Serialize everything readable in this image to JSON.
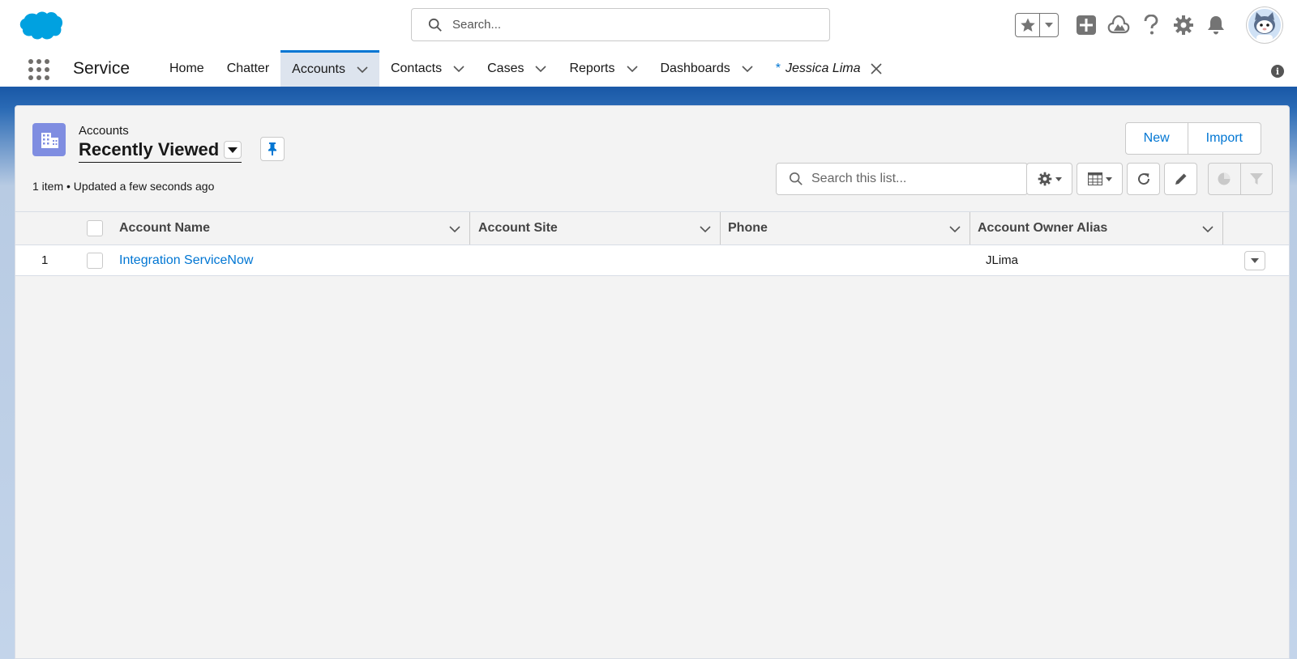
{
  "header": {
    "search_placeholder": "Search...",
    "icons": [
      "salesforce-cloud-logo",
      "star-icon",
      "chevron-down-icon",
      "plus-icon",
      "trailhead-icon",
      "help-icon",
      "gear-icon",
      "bell-icon",
      "avatar"
    ]
  },
  "nav": {
    "app_name": "Service",
    "tabs": [
      {
        "label": "Home"
      },
      {
        "label": "Chatter"
      },
      {
        "label": "Accounts"
      },
      {
        "label": "Contacts"
      },
      {
        "label": "Cases"
      },
      {
        "label": "Reports"
      },
      {
        "label": "Dashboards"
      },
      {
        "label": "Jessica Lima",
        "prefix": "*"
      }
    ],
    "info_glyph": "i"
  },
  "list": {
    "object_label": "Accounts",
    "view_name": "Recently Viewed",
    "meta": "1 item • Updated a few seconds ago",
    "buttons": {
      "new": "New",
      "import": "Import"
    },
    "search_placeholder": "Search this list..."
  },
  "table": {
    "columns": [
      "Account Name",
      "Account Site",
      "Phone",
      "Account Owner Alias"
    ],
    "rows": [
      {
        "num": "1",
        "account_name": "Integration ServiceNow",
        "account_site": "",
        "phone": "",
        "owner_alias": "JLima"
      }
    ]
  },
  "colors": {
    "brand_blue": "#0176d3",
    "nav_band": "#1b5aa8",
    "object_icon": "#7f8de1",
    "salesforce_cloud": "#00a1e0"
  }
}
